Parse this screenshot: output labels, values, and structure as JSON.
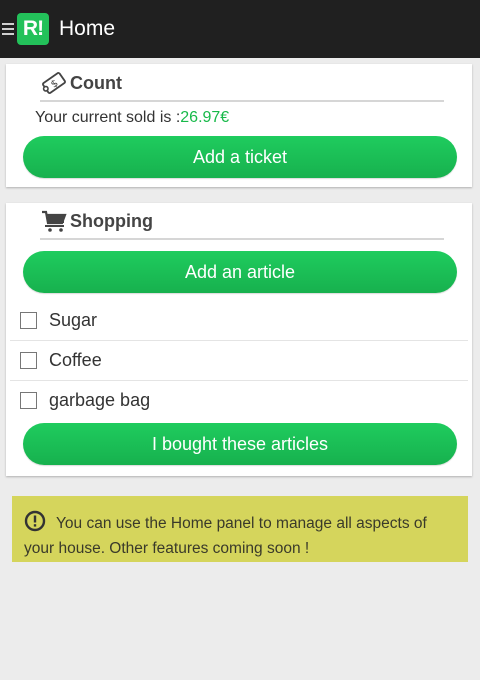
{
  "app": {
    "logo_text": "R!",
    "title": "Home",
    "accent_color": "#23c15a"
  },
  "count": {
    "title": "Count",
    "sold_prefix": "Your current sold is :",
    "sold_amount": "26.97€",
    "add_ticket_label": "Add a ticket"
  },
  "shopping": {
    "title": "Shopping",
    "add_article_label": "Add an article",
    "items": [
      {
        "label": "Sugar",
        "checked": false
      },
      {
        "label": "Coffee",
        "checked": false
      },
      {
        "label": "garbage bag",
        "checked": false
      }
    ],
    "bought_label": "I bought these articles"
  },
  "notice": {
    "text": "You can use the Home panel to manage all aspects of your house. Other features coming soon !",
    "background_color": "#d5d55c"
  },
  "icons": {
    "menu": "menu-icon",
    "count": "ticket-icon",
    "shopping": "cart-icon",
    "notice": "alert-circle-icon"
  }
}
